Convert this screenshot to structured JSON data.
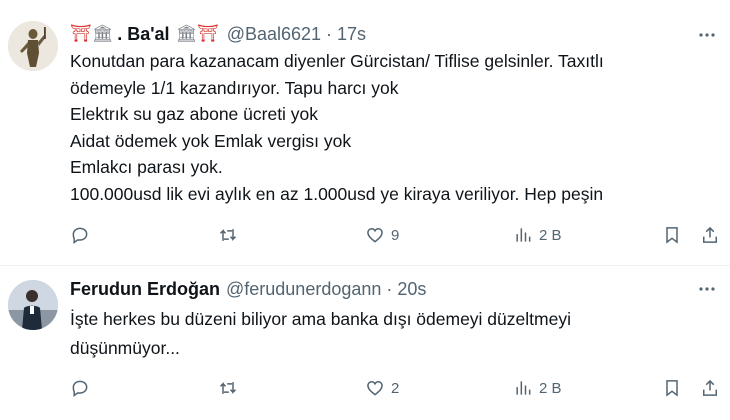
{
  "tweets": [
    {
      "name_prefix_emojis": "⛩🏛",
      "name": ". Ba'al",
      "name_suffix_emojis": "🏛⛩",
      "handle": "@Baal6621",
      "separator": "·",
      "time": "17s",
      "more_icon": "more-horizontal-icon",
      "avatar": "statue-figure-avatar",
      "body_lines": [
        "Konutdan para kazanacam diyenler Gürcistan/ Tiflise gelsinler. Taxıtlı",
        "ödemeyle 1/1 kazandırıyor. Tapu harcı yok",
        "Elektrık su gaz abone ücreti yok",
        "Aidat ödemek yok Emlak vergisı yok",
        "Emlakcı parası yok.",
        "100.000usd lik evi aylık en az 1.000usd ye kiraya veriliyor. Hep peşin"
      ],
      "actions": {
        "reply_count": "",
        "retweet_count": "",
        "like_count": "9",
        "views_count": "2 B"
      }
    },
    {
      "name": "Ferudun Erdoğan",
      "handle": "@ferudunerdogann",
      "separator": "·",
      "time": "20s",
      "more_icon": "more-horizontal-icon",
      "avatar": "person-photo-avatar",
      "body_lines": [
        "İşte herkes bu düzeni biliyor ama banka dışı ödemeyi düzeltmeyi",
        "düşünmüyor..."
      ],
      "actions": {
        "reply_count": "",
        "retweet_count": "",
        "like_count": "2",
        "views_count": "2 B"
      }
    }
  ],
  "colors": {
    "text": "#0f1419",
    "secondary": "#536471",
    "divider": "#eff3f4",
    "torii_red": "#d9312b"
  }
}
